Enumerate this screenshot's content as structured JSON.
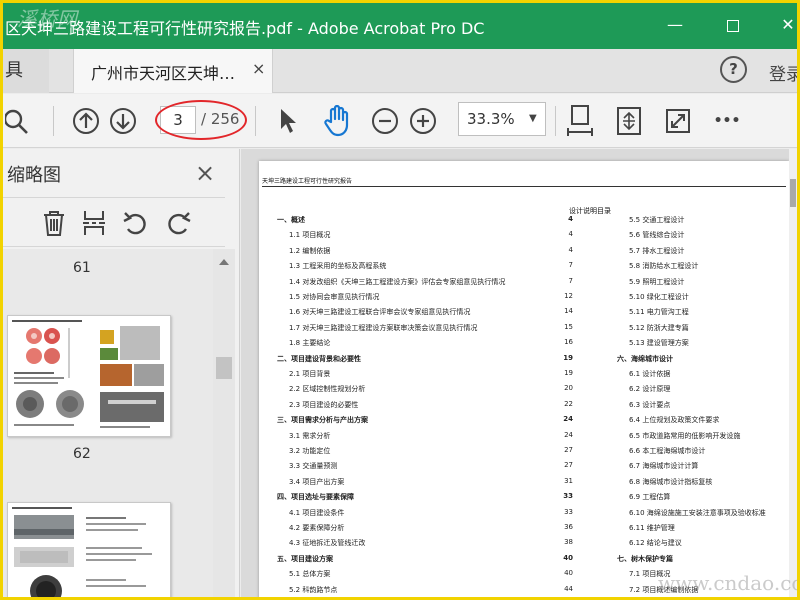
{
  "window": {
    "title": "区天坤三路建设工程可行性研究报告.pdf - Adobe Acrobat Pro DC",
    "minimize_label": "—",
    "close_label": "✕"
  },
  "tabs": {
    "home_label": "具",
    "doc_label": "广州市天河区天坤…",
    "doc_close": "×",
    "help_label": "?",
    "login_label": "登录"
  },
  "toolbar": {
    "current_page": "3",
    "page_total": "/ 256",
    "zoom": "33.3%",
    "zoom_caret": "▼",
    "more_label": "•••"
  },
  "left_pane": {
    "title": "缩略图",
    "close_label": "×",
    "page_numbers": [
      "61",
      "62"
    ]
  },
  "document": {
    "header": "天坤三路建设工程可行性研究报告",
    "toc_title": "设计说明目录",
    "toc_left": [
      {
        "title": "一、概述",
        "page": "4",
        "chapter": true
      },
      {
        "title": "1.1 项目概况",
        "page": "4"
      },
      {
        "title": "1.2 编制依据",
        "page": "4"
      },
      {
        "title": "1.3 工程采用的坐标及高程系统",
        "page": "7"
      },
      {
        "title": "1.4 对发改组织《天坤三路工程建设方案》评估会专家组意见执行情况",
        "page": "7"
      },
      {
        "title": "1.5 对协同会审意见执行情况",
        "page": "12"
      },
      {
        "title": "1.6 对天坤三路建设工程联合评审会议专家组意见执行情况",
        "page": "14"
      },
      {
        "title": "1.7 对天坤三路建设工程建设方案联审决策会议意见执行情况",
        "page": "15"
      },
      {
        "title": "1.8 主要结论",
        "page": "16"
      },
      {
        "title": "二、项目建设背景和必要性",
        "page": "19",
        "chapter": true
      },
      {
        "title": "2.1 项目背景",
        "page": "19"
      },
      {
        "title": "2.2 区域控制性规划分析",
        "page": "20"
      },
      {
        "title": "2.3 项目建设的必要性",
        "page": "22"
      },
      {
        "title": "三、项目需求分析与产出方案",
        "page": "24",
        "chapter": true
      },
      {
        "title": "3.1 需求分析",
        "page": "24"
      },
      {
        "title": "3.2 功能定位",
        "page": "27"
      },
      {
        "title": "3.3 交通量预测",
        "page": "27"
      },
      {
        "title": "3.4 项目产出方案",
        "page": "31"
      },
      {
        "title": "四、项目选址与要素保障",
        "page": "33",
        "chapter": true
      },
      {
        "title": "4.1 项目建设条件",
        "page": "33"
      },
      {
        "title": "4.2 要素保障分析",
        "page": "36"
      },
      {
        "title": "4.3 征地拆迁及管线迁改",
        "page": "38"
      },
      {
        "title": "五、项目建设方案",
        "page": "40",
        "chapter": true
      },
      {
        "title": "5.1 总体方案",
        "page": "40"
      },
      {
        "title": "5.2 科韵路节点",
        "page": "44"
      }
    ],
    "toc_right": [
      {
        "title": "5.5 交通工程设计",
        "page": ""
      },
      {
        "title": "5.6 管线综合设计",
        "page": ""
      },
      {
        "title": "5.7 排水工程设计",
        "page": ""
      },
      {
        "title": "5.8 消防给水工程设计",
        "page": ""
      },
      {
        "title": "5.9 照明工程设计",
        "page": ""
      },
      {
        "title": "5.10 绿化工程设计",
        "page": ""
      },
      {
        "title": "5.11 电力管沟工程",
        "page": ""
      },
      {
        "title": "5.12 防浙大建专篇",
        "page": ""
      },
      {
        "title": "5.13 建设管理方案",
        "page": ""
      },
      {
        "title": "六、海绵城市设计",
        "page": "",
        "chapter": true
      },
      {
        "title": "6.1 设计依据",
        "page": ""
      },
      {
        "title": "6.2 设计原理",
        "page": ""
      },
      {
        "title": "6.3 设计要点",
        "page": ""
      },
      {
        "title": "6.4 上位规划及政策文件要求",
        "page": ""
      },
      {
        "title": "6.5 市政道路常用的低影响开发设施",
        "page": ""
      },
      {
        "title": "6.6 本工程海绵城市设计",
        "page": ""
      },
      {
        "title": "6.7 海绵城市设计计算",
        "page": ""
      },
      {
        "title": "6.8 海绵城市设计指标复核",
        "page": ""
      },
      {
        "title": "6.9 工程估算",
        "page": ""
      },
      {
        "title": "6.10 海绵设施施工安装注意事项及验收标准",
        "page": ""
      },
      {
        "title": "6.11 维护管理",
        "page": ""
      },
      {
        "title": "6.12 结论与建议",
        "page": ""
      },
      {
        "title": "七、树木保护专篇",
        "page": "",
        "chapter": true
      },
      {
        "title": "7.1 项目概况",
        "page": ""
      },
      {
        "title": "7.2 项目概述编制依据",
        "page": ""
      }
    ]
  },
  "watermarks": {
    "top_left": "溪桥网",
    "bottom_right": "www.cndao.com"
  },
  "colors": {
    "title_bar": "#1e9a57",
    "page_annotation": "#e2262a",
    "frame_border": "#f2d300"
  }
}
